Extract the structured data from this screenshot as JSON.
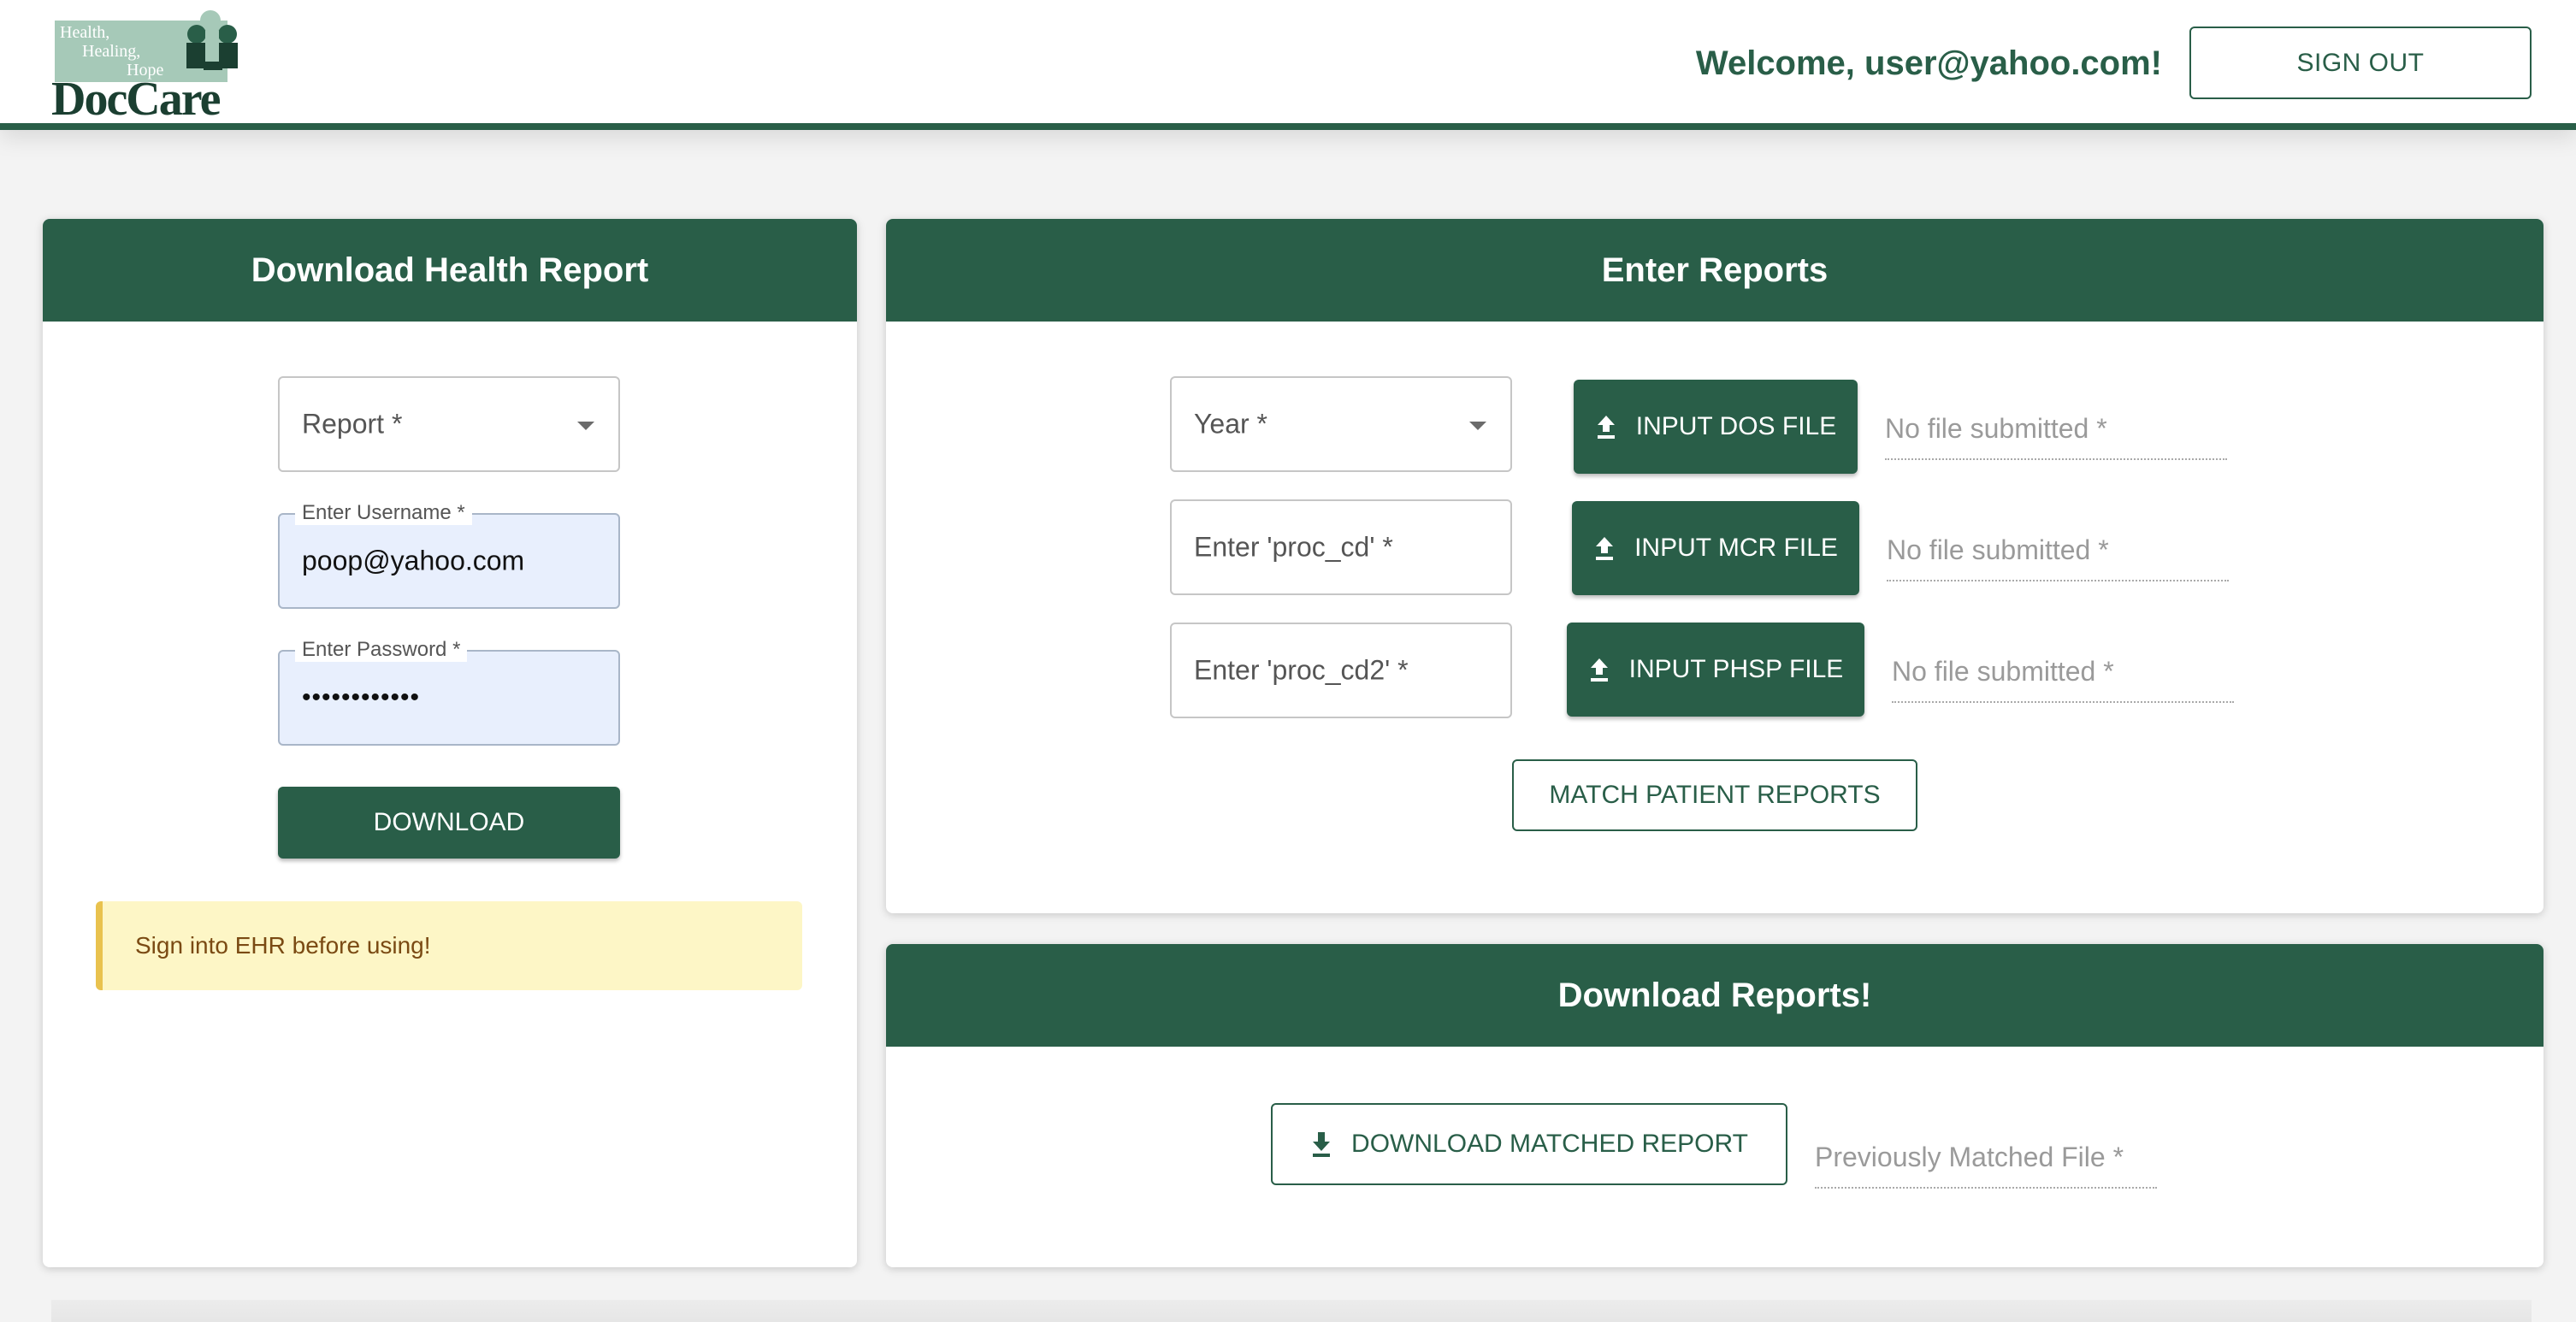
{
  "colors": {
    "brand_green": "#295e48",
    "alert_bg": "#fdf6c6",
    "alert_border": "#e9c24e",
    "autofill_bg": "#e8effd"
  },
  "header": {
    "logo": {
      "tagline": [
        "Health,",
        "Healing,",
        "Hope"
      ],
      "brand": "DocCare"
    },
    "welcome": "Welcome, user@yahoo.com!",
    "signout_label": "SIGN OUT"
  },
  "health_report": {
    "title": "Download Health Report",
    "report_select": {
      "label": "Report *",
      "icon": "chevron-down-icon"
    },
    "username": {
      "label": "Enter Username *",
      "value": "poop@yahoo.com"
    },
    "password": {
      "label": "Enter Password *",
      "value": "••••••••••••"
    },
    "download_label": "DOWNLOAD",
    "alert": "Sign into EHR before using!"
  },
  "enter_reports": {
    "title": "Enter Reports",
    "year_select": {
      "label": "Year *",
      "icon": "chevron-down-icon"
    },
    "proc_cd": {
      "placeholder": "Enter 'proc_cd' *"
    },
    "proc_cd2": {
      "placeholder": "Enter 'proc_cd2' *"
    },
    "upload_buttons": [
      {
        "label": "INPUT DOS FILE",
        "icon": "upload-icon"
      },
      {
        "label": "INPUT MCR FILE",
        "icon": "upload-icon"
      },
      {
        "label": "INPUT PHSP FILE",
        "icon": "upload-icon"
      }
    ],
    "file_status": [
      "No file submitted *",
      "No file submitted *",
      "No file submitted *"
    ],
    "match_label": "MATCH PATIENT REPORTS"
  },
  "download_reports": {
    "title": "Download Reports!",
    "download_matched_label": "DOWNLOAD MATCHED REPORT",
    "download_icon": "download-icon",
    "previous_file_placeholder": "Previously Matched File *"
  }
}
